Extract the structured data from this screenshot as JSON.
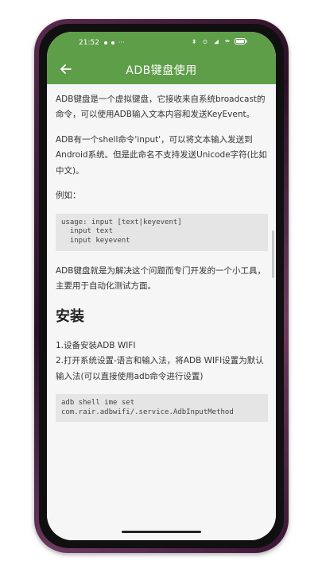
{
  "status_bar": {
    "time": "21:52",
    "left_icons": [
      "notification-dot-icon",
      "notification-dot-icon",
      "more-icon"
    ],
    "right_icons": [
      "bluetooth-icon",
      "sync-icon",
      "signal-icon",
      "wifi-icon",
      "battery-icon"
    ]
  },
  "app_bar": {
    "title": "ADB键盘使用",
    "color": "#5e9e49"
  },
  "content": {
    "para1": "ADB键盘是一个虚拟键盘，它接收来自系统broadcast的命令，可以使用ADB输入文本内容和发送KeyEvent。",
    "para2": "ADB有一个shell命令'input'，可以将文本输入发送到Android系统。但是此命名不支持发送Unicode字符(比如中文)。",
    "para3": "例如：",
    "code1": "usage: input [text|keyevent]\n  input text\n  input keyevent",
    "para4": "ADB键盘就是为解决这个问题而专门开发的一个小工具，主要用于自动化测试方面。",
    "heading_install": "安装",
    "step1": "1.设备安装ADB WIFI",
    "step2": "2.打开系统设置-语言和输入法，将ADB WIFI设置为默认输入法(可以直接使用adb命令进行设置)",
    "code2": "adb shell ime set\ncom.rair.adbwifi/.service.AdbInputMethod"
  }
}
